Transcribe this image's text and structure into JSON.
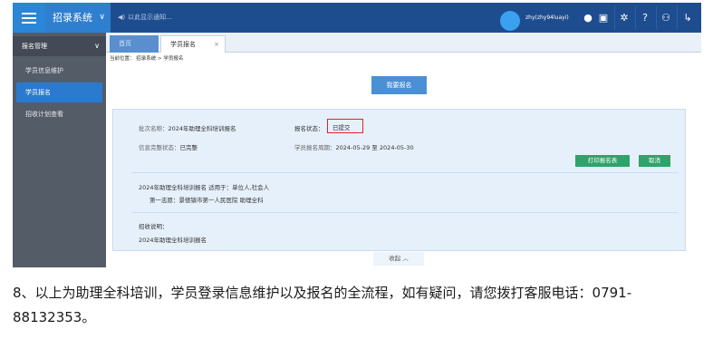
{
  "topbar": {
    "system_title": "招录系统",
    "notice": "以此显示通知...",
    "username": "zhy(zhy94luayi)",
    "icons": [
      "wechat-icon",
      "message-icon",
      "gear-icon",
      "help-icon",
      "user-settings-icon",
      "logout-icon"
    ]
  },
  "sidebar": {
    "group_label": "报名管理",
    "items": [
      {
        "label": "学员信息维护"
      },
      {
        "label": "学员报名"
      },
      {
        "label": "招收计划查看"
      }
    ]
  },
  "tabs": [
    {
      "label": "首页"
    },
    {
      "label": "学员报名",
      "close": "×"
    }
  ],
  "breadcrumb": "当前位置：  招录系统 > 学员报名",
  "enroll_button": "我要报名",
  "card": {
    "batch_label": "批次名称：",
    "batch_value": "2024年助理全科培训报名",
    "status_label": "报名状态：",
    "status_value": "已提交",
    "info_label": "信息完整状态：",
    "info_value": "已完整",
    "period_label": "学员报名周期：",
    "period_value": "2024-05-29 至 2024-05-30",
    "print_button": "打印报名表",
    "cancel_button": "取消",
    "detail_line1": "2024年助理全科培训报名  适用于：单位人,社会人",
    "detail_line2": "第一志愿：景德镇市第一人民医院    助理全科",
    "note_label": "招收说明：",
    "note_value": "2024年助理全科培训报名",
    "collapse_label": "收起 ︿"
  },
  "caption": "8、以上为助理全科培训，学员登录信息维护以及报名的全流程，如有疑问，请您拨打客服电话：0791-88132353。",
  "colors": {
    "topbar": "#1d4d8f",
    "accent": "#2a7ad0",
    "sidebar": "#545c68",
    "green_button": "#2ea36a",
    "highlight": "#e02424"
  }
}
